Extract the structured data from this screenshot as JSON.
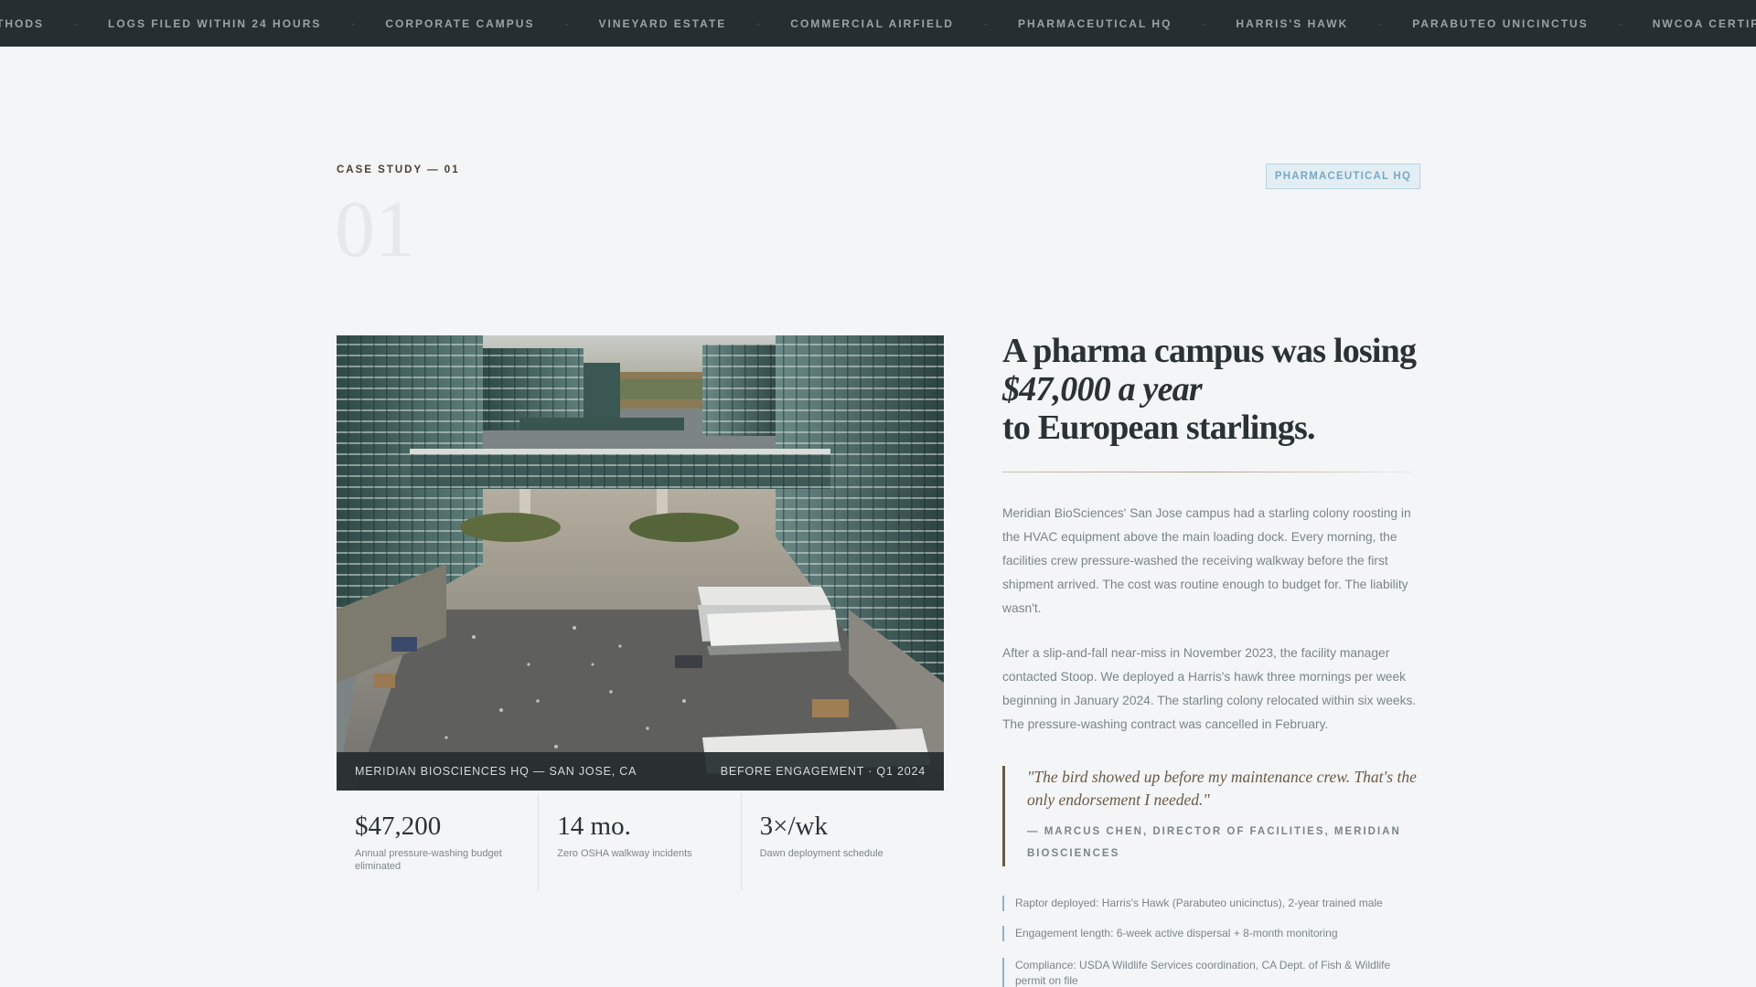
{
  "ticker": {
    "items": [
      "ETHODS",
      "LOGS FILED WITHIN 24 HOURS",
      "CORPORATE CAMPUS",
      "VINEYARD ESTATE",
      "COMMERCIAL AIRFIELD",
      "PHARMACEUTICAL HQ",
      "HARRIS'S HAWK",
      "PARABUTEO UNICINCTUS",
      "NWCOA CERTIFIED"
    ],
    "separator": "·"
  },
  "case": {
    "eyebrow": "CASE STUDY — 01",
    "number": "01",
    "tag": "PHARMACEUTICAL HQ"
  },
  "photo": {
    "caption_left": "MERIDIAN BIOSCIENCES HQ — SAN JOSE, CA",
    "caption_right": "BEFORE ENGAGEMENT · Q1 2024"
  },
  "stats": [
    {
      "value": "$47,200",
      "label": "Annual pressure-washing budget eliminated"
    },
    {
      "value": "14 mo.",
      "label": "Zero OSHA walkway incidents"
    },
    {
      "value": "3×/wk",
      "label": "Dawn deployment schedule"
    }
  ],
  "headline": {
    "line1": "A pharma campus was losing",
    "line2": "$47,000 a year",
    "line3": "to European starlings."
  },
  "body": {
    "p1": "Meridian BioSciences' San Jose campus had a starling colony roosting in the HVAC equipment above the main loading dock. Every morning, the facilities crew pressure-washed the receiving walkway before the first shipment arrived. The cost was routine enough to budget for. The liability wasn't.",
    "p2": "After a slip-and-fall near-miss in November 2023, the facility manager contacted Stoop. We deployed a Harris's hawk three mornings per week beginning in January 2024. The starling colony relocated within six weeks. The pressure-washing contract was cancelled in February."
  },
  "quote": {
    "text": "\"The bird showed up before my maintenance crew. That's the only endorsement I needed.\"",
    "attribution": "— MARCUS CHEN, DIRECTOR OF FACILITIES, MERIDIAN BIOSCIENCES"
  },
  "facts": [
    "Raptor deployed: Harris's Hawk (Parabuteo unicinctus), 2-year trained male",
    "Engagement length: 6-week active dispersal + 8-month monitoring",
    "Compliance: USDA Wildlife Services coordination, CA Dept. of Fish & Wildlife permit on file"
  ]
}
